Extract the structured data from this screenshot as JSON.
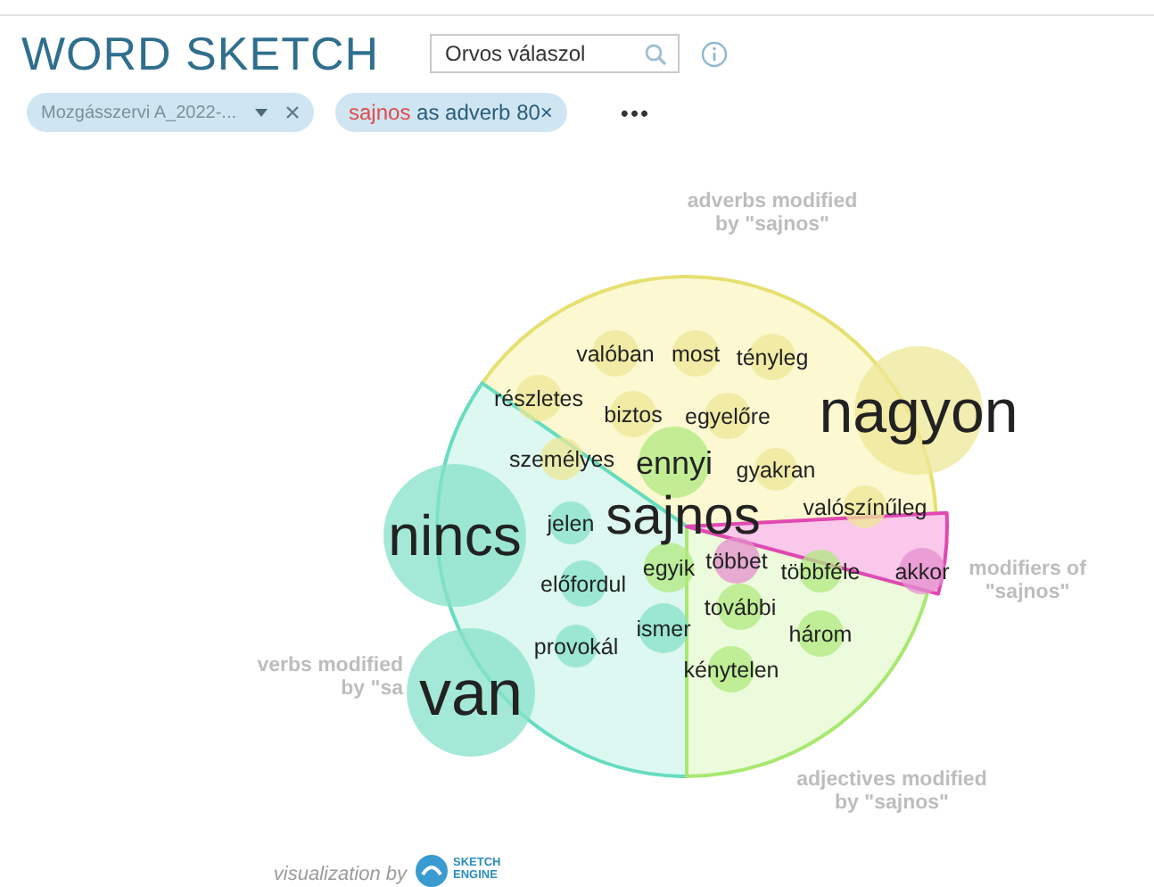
{
  "title": "WORD SKETCH",
  "search": {
    "value": "Orvos válaszol"
  },
  "filters": [
    {
      "kind": "corpus",
      "text": "Mozgásszervi A_2022-..."
    },
    {
      "kind": "query",
      "headword": "sajnos",
      "text": "as adverb 80×"
    }
  ],
  "more": "•••",
  "sketch": {
    "headword": "sajnos",
    "groups": [
      {
        "kind": "adverbs",
        "label": [
          "adverbs modified",
          "by \"sajnos\""
        ],
        "words": [
          "valóban",
          "most",
          "tényleg",
          "részletes",
          "biztos",
          "egyelőre",
          "nagyon",
          "személyes",
          "gyakran",
          "valószínűleg"
        ]
      },
      {
        "kind": "verbs",
        "label": [
          "verbs modified",
          "by \"sa"
        ],
        "words": [
          "nincs",
          "jelen",
          "előfordul",
          "provokál",
          "ismer",
          "van"
        ]
      },
      {
        "kind": "adjectives",
        "label": [
          "adjectives modified",
          "by \"sajnos\""
        ],
        "words": [
          "ennyi",
          "egyik",
          "többféle",
          "további",
          "három",
          "kénytelen"
        ]
      },
      {
        "kind": "modifiers",
        "label": [
          "modifiers of",
          "\"sajnos\""
        ],
        "words": [
          "többet",
          "akkor"
        ]
      }
    ]
  },
  "footer": {
    "caption": "visualization by",
    "logo": [
      "SKETCH",
      "ENGINE"
    ]
  }
}
